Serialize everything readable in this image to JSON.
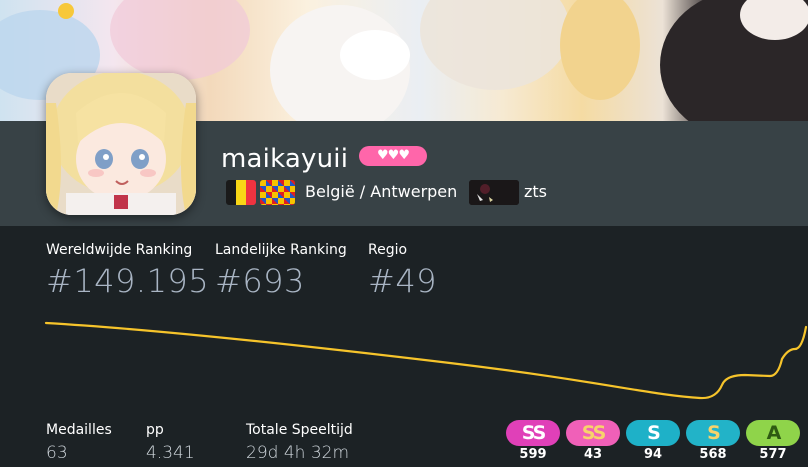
{
  "profile": {
    "username": "maikayuii",
    "supporter_badge": "♥♥♥",
    "location": "België / Antwerpen",
    "team": "zts",
    "country_flag": "belgium-flag-icon",
    "region_flag": "antwerp-flag-icon"
  },
  "rankings": {
    "global_label": "Wereldwijde Ranking",
    "global_value": "#149.195",
    "country_label": "Landelijke Ranking",
    "country_value": "#693",
    "region_label": "Regio",
    "region_value": "#49"
  },
  "rank_history": {
    "line_color": "#f6c42b"
  },
  "stats": {
    "medals_label": "Medailles",
    "medals_value": "63",
    "pp_label": "pp",
    "pp_value": "4.341",
    "playtime_label": "Totale Speeltijd",
    "playtime_value": "29d 4h 32m"
  },
  "grades": [
    {
      "grade": "SS",
      "count": "599",
      "bg": "#e040b8",
      "fg": "#ffffff"
    },
    {
      "grade": "SS",
      "count": "43",
      "bg": "#f060b8",
      "fg": "#f7d36b"
    },
    {
      "grade": "S",
      "count": "94",
      "bg": "#1eb1c8",
      "fg": "#ffffff"
    },
    {
      "grade": "S",
      "count": "568",
      "bg": "#22b3c8",
      "fg": "#f7d36b"
    },
    {
      "grade": "A",
      "count": "577",
      "bg": "#8fd44a",
      "fg": "#2e5a12"
    }
  ]
}
